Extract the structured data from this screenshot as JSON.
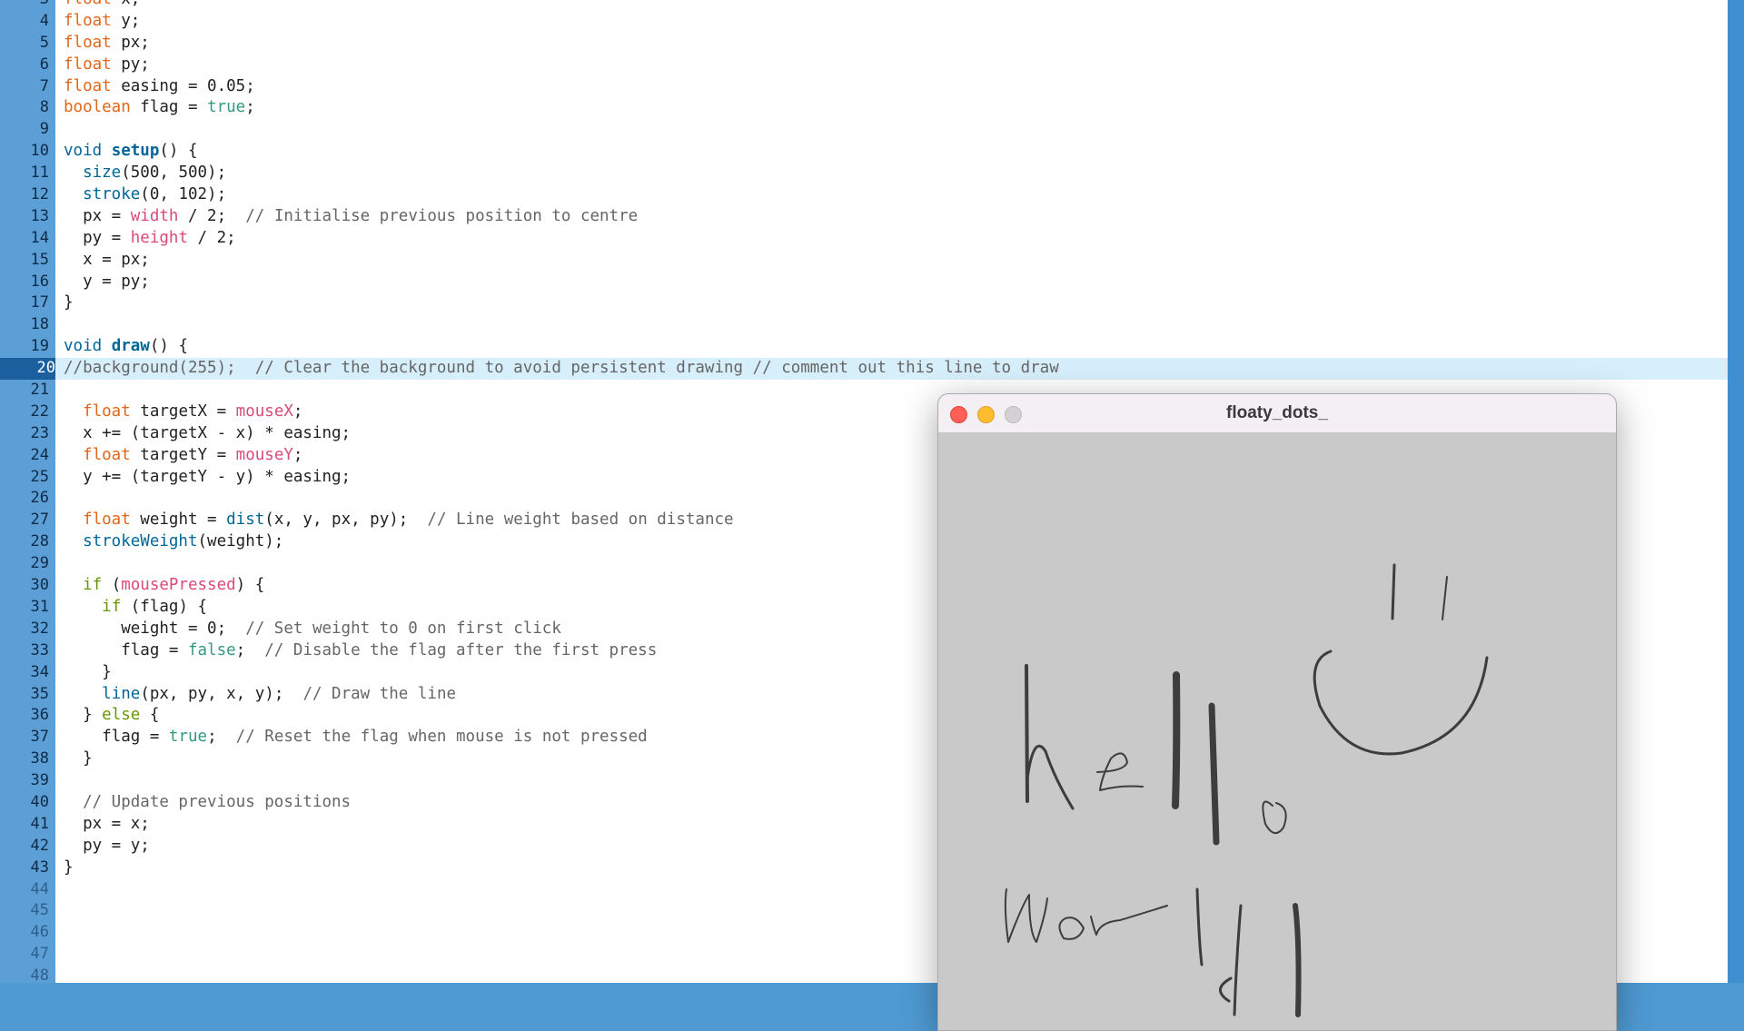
{
  "editor": {
    "highlight_line": "20",
    "lines": [
      {
        "n": "3",
        "segs": [
          {
            "t": "float",
            "c": "kw-o"
          },
          {
            "t": " x;"
          }
        ]
      },
      {
        "n": "4",
        "segs": [
          {
            "t": "float",
            "c": "kw-o"
          },
          {
            "t": " y;"
          }
        ]
      },
      {
        "n": "5",
        "segs": [
          {
            "t": "float",
            "c": "kw-o"
          },
          {
            "t": " px;"
          }
        ]
      },
      {
        "n": "6",
        "segs": [
          {
            "t": "float",
            "c": "kw-o"
          },
          {
            "t": " py;"
          }
        ]
      },
      {
        "n": "7",
        "segs": [
          {
            "t": "float",
            "c": "kw-o"
          },
          {
            "t": " easing = 0.05;"
          }
        ]
      },
      {
        "n": "8",
        "segs": [
          {
            "t": "boolean",
            "c": "kw-o"
          },
          {
            "t": " flag = "
          },
          {
            "t": "true",
            "c": "kw-g"
          },
          {
            "t": ";"
          }
        ]
      },
      {
        "n": "9",
        "segs": []
      },
      {
        "n": "10",
        "segs": [
          {
            "t": "void",
            "c": "kw-b"
          },
          {
            "t": " "
          },
          {
            "t": "setup",
            "c": "kw-bold"
          },
          {
            "t": "() {"
          }
        ]
      },
      {
        "n": "11",
        "segs": [
          {
            "t": "  "
          },
          {
            "t": "size",
            "c": "kw-b"
          },
          {
            "t": "(500, 500);"
          }
        ]
      },
      {
        "n": "12",
        "segs": [
          {
            "t": "  "
          },
          {
            "t": "stroke",
            "c": "kw-b"
          },
          {
            "t": "(0, 102);"
          }
        ]
      },
      {
        "n": "13",
        "segs": [
          {
            "t": "  px = "
          },
          {
            "t": "width",
            "c": "kw-p"
          },
          {
            "t": " / 2;  "
          },
          {
            "t": "// Initialise previous position to centre",
            "c": "kw-c"
          }
        ]
      },
      {
        "n": "14",
        "segs": [
          {
            "t": "  py = "
          },
          {
            "t": "height",
            "c": "kw-p"
          },
          {
            "t": " / 2;"
          }
        ]
      },
      {
        "n": "15",
        "segs": [
          {
            "t": "  x = px;"
          }
        ]
      },
      {
        "n": "16",
        "segs": [
          {
            "t": "  y = py;"
          }
        ]
      },
      {
        "n": "17",
        "segs": [
          {
            "t": "}"
          }
        ]
      },
      {
        "n": "18",
        "segs": []
      },
      {
        "n": "19",
        "segs": [
          {
            "t": "void",
            "c": "kw-b"
          },
          {
            "t": " "
          },
          {
            "t": "draw",
            "c": "kw-bold"
          },
          {
            "t": "() {"
          }
        ]
      },
      {
        "n": "20",
        "segs": [
          {
            "t": "//background(255);  // Clear the background to avoid persistent drawing // comment out this line to draw",
            "c": "kw-c"
          }
        ]
      },
      {
        "n": "21",
        "segs": []
      },
      {
        "n": "22",
        "segs": [
          {
            "t": "  "
          },
          {
            "t": "float",
            "c": "kw-o"
          },
          {
            "t": " targetX = "
          },
          {
            "t": "mouseX",
            "c": "kw-p"
          },
          {
            "t": ";"
          }
        ]
      },
      {
        "n": "23",
        "segs": [
          {
            "t": "  x += (targetX - x) * easing;"
          }
        ]
      },
      {
        "n": "24",
        "segs": [
          {
            "t": "  "
          },
          {
            "t": "float",
            "c": "kw-o"
          },
          {
            "t": " targetY = "
          },
          {
            "t": "mouseY",
            "c": "kw-p"
          },
          {
            "t": ";"
          }
        ]
      },
      {
        "n": "25",
        "segs": [
          {
            "t": "  y += (targetY - y) * easing;"
          }
        ]
      },
      {
        "n": "26",
        "segs": []
      },
      {
        "n": "27",
        "segs": [
          {
            "t": "  "
          },
          {
            "t": "float",
            "c": "kw-o"
          },
          {
            "t": " weight = "
          },
          {
            "t": "dist",
            "c": "kw-b"
          },
          {
            "t": "(x, y, px, py);  "
          },
          {
            "t": "// Line weight based on distance",
            "c": "kw-c"
          }
        ]
      },
      {
        "n": "28",
        "segs": [
          {
            "t": "  "
          },
          {
            "t": "strokeWeight",
            "c": "kw-b"
          },
          {
            "t": "(weight);"
          }
        ]
      },
      {
        "n": "29",
        "segs": []
      },
      {
        "n": "30",
        "segs": [
          {
            "t": "  "
          },
          {
            "t": "if",
            "c": "kw-green"
          },
          {
            "t": " ("
          },
          {
            "t": "mousePressed",
            "c": "kw-p"
          },
          {
            "t": ") {"
          }
        ]
      },
      {
        "n": "31",
        "segs": [
          {
            "t": "    "
          },
          {
            "t": "if",
            "c": "kw-green"
          },
          {
            "t": " (flag) {"
          }
        ]
      },
      {
        "n": "32",
        "segs": [
          {
            "t": "      weight = 0;  "
          },
          {
            "t": "// Set weight to 0 on first click",
            "c": "kw-c"
          }
        ]
      },
      {
        "n": "33",
        "segs": [
          {
            "t": "      flag = "
          },
          {
            "t": "false",
            "c": "kw-g"
          },
          {
            "t": ";  "
          },
          {
            "t": "// Disable the flag after the first press",
            "c": "kw-c"
          }
        ]
      },
      {
        "n": "34",
        "segs": [
          {
            "t": "    }"
          }
        ]
      },
      {
        "n": "35",
        "segs": [
          {
            "t": "    "
          },
          {
            "t": "line",
            "c": "kw-b"
          },
          {
            "t": "(px, py, x, y);  "
          },
          {
            "t": "// Draw the line",
            "c": "kw-c"
          }
        ]
      },
      {
        "n": "36",
        "segs": [
          {
            "t": "  } "
          },
          {
            "t": "else",
            "c": "kw-green"
          },
          {
            "t": " {"
          }
        ]
      },
      {
        "n": "37",
        "segs": [
          {
            "t": "    flag = "
          },
          {
            "t": "true",
            "c": "kw-g"
          },
          {
            "t": ";  "
          },
          {
            "t": "// Reset the flag when mouse is not pressed",
            "c": "kw-c"
          }
        ]
      },
      {
        "n": "38",
        "segs": [
          {
            "t": "  }"
          }
        ]
      },
      {
        "n": "39",
        "segs": []
      },
      {
        "n": "40",
        "segs": [
          {
            "t": "  "
          },
          {
            "t": "// Update previous positions",
            "c": "kw-c"
          }
        ]
      },
      {
        "n": "41",
        "segs": [
          {
            "t": "  px = x;"
          }
        ]
      },
      {
        "n": "42",
        "segs": [
          {
            "t": "  py = y;"
          }
        ]
      },
      {
        "n": "43",
        "segs": [
          {
            "t": "}"
          }
        ]
      },
      {
        "n": "44",
        "segs": [],
        "dim": true
      },
      {
        "n": "45",
        "segs": [],
        "dim": true
      },
      {
        "n": "46",
        "segs": [],
        "dim": true
      },
      {
        "n": "47",
        "segs": [],
        "dim": true
      },
      {
        "n": "48",
        "segs": [],
        "dim": true
      }
    ]
  },
  "sketch_window": {
    "title": "floaty_dots_",
    "buttons": {
      "close": "close-icon",
      "minimize": "minimize-icon",
      "maximize": "maximize-icon"
    },
    "canvas_color": "#c9c9c9"
  }
}
